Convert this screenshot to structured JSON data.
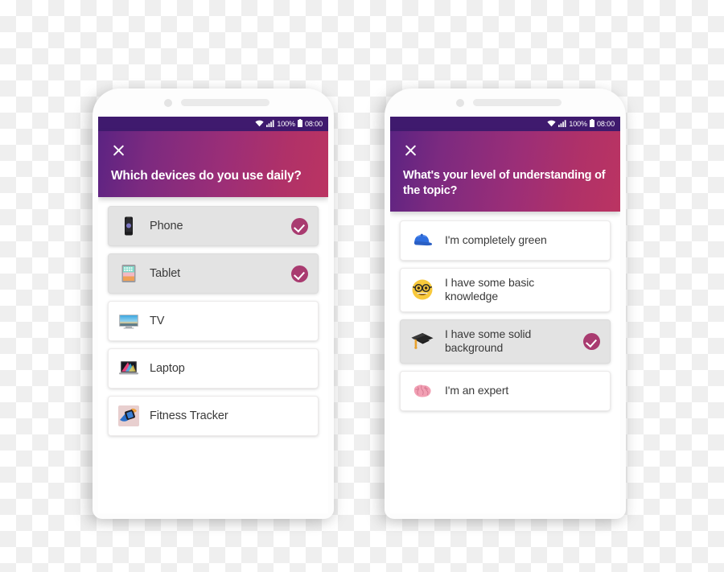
{
  "statusbar": {
    "wifi_icon": "wifi-icon",
    "signal_icon": "signal-bars-icon",
    "battery_percent": "100%",
    "battery_icon": "battery-full-icon",
    "clock": "08:00"
  },
  "theme": {
    "header_gradient_start": "#5b2382",
    "header_gradient_end": "#bb3462",
    "statusbar_color": "#3f1a6e",
    "check_badge_color": "#a93b70",
    "selected_row_bg": "#e3e3e3"
  },
  "screens": [
    {
      "id": "devices-screen",
      "close_label": "close-icon",
      "title": "Which devices do you use daily?",
      "options": [
        {
          "label": "Phone",
          "icon": "phone-icon",
          "selected": true
        },
        {
          "label": "Tablet",
          "icon": "tablet-icon",
          "selected": true
        },
        {
          "label": "TV",
          "icon": "tv-icon",
          "selected": false
        },
        {
          "label": "Laptop",
          "icon": "laptop-icon",
          "selected": false
        },
        {
          "label": "Fitness Tracker",
          "icon": "fitness-tracker-icon",
          "selected": false
        }
      ]
    },
    {
      "id": "understanding-screen",
      "close_label": "close-icon",
      "title": "What's your level of understanding of the topic?",
      "options": [
        {
          "label": "I'm completely green",
          "icon": "blue-cap-emoji",
          "selected": false
        },
        {
          "label": "I have some basic knowledge",
          "icon": "nerd-face-emoji",
          "selected": false
        },
        {
          "label": "I have some solid background",
          "icon": "graduation-cap-emoji",
          "selected": true
        },
        {
          "label": "I'm an expert",
          "icon": "brain-emoji",
          "selected": false
        }
      ]
    }
  ]
}
